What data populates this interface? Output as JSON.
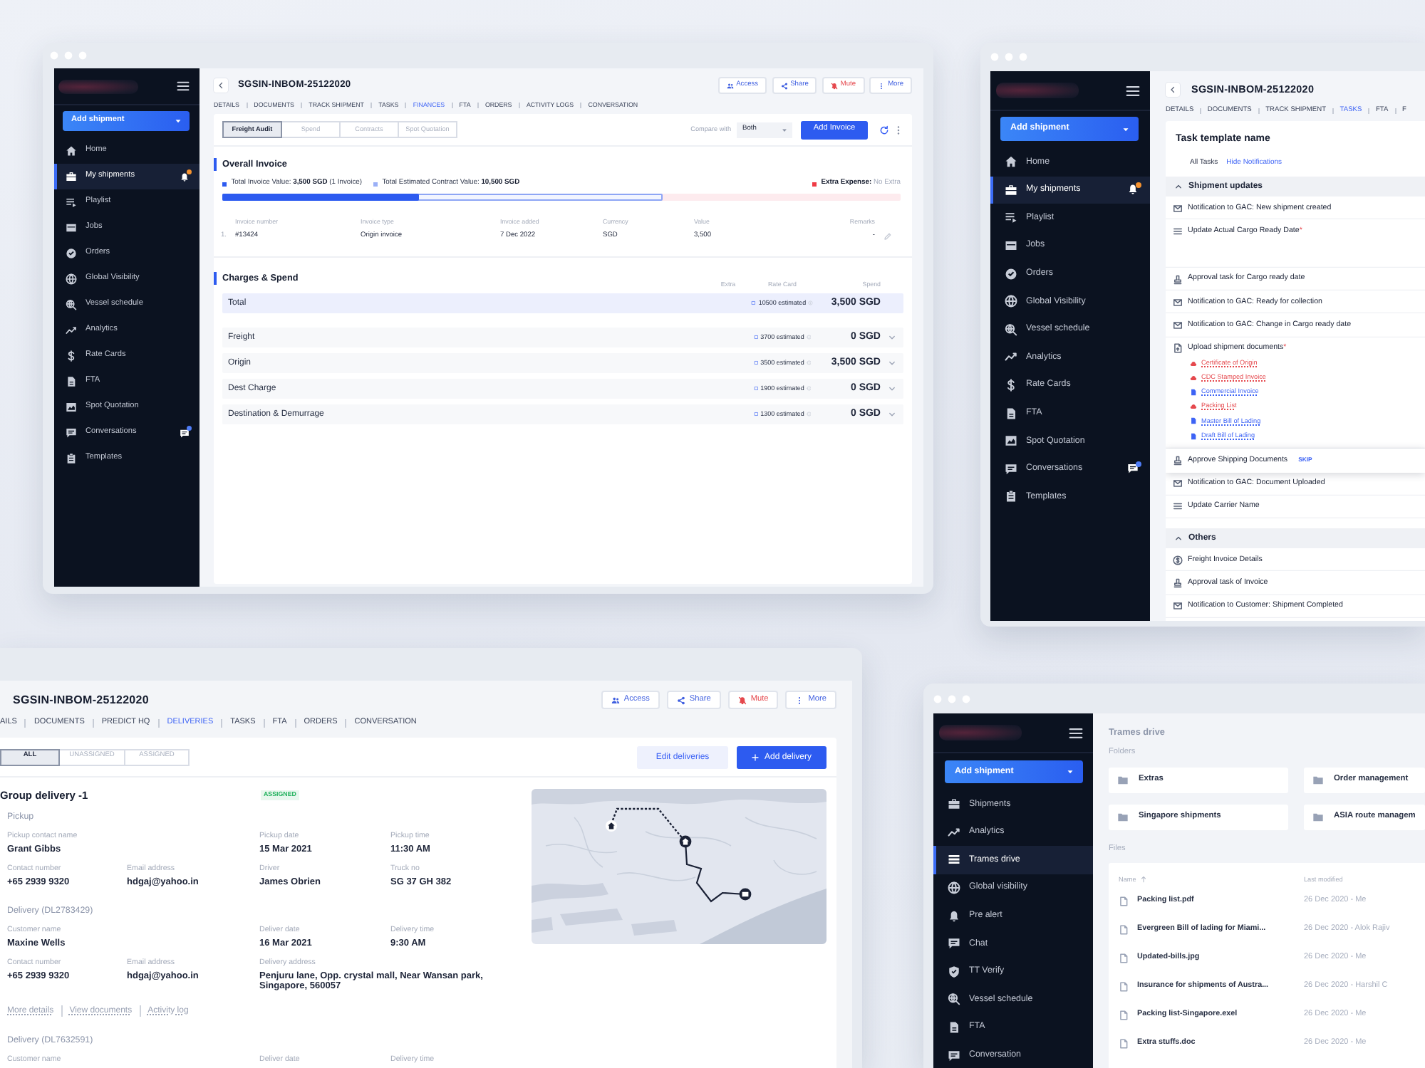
{
  "windows": [
    {
      "kind": "finances",
      "sidebar": {
        "add_button": "Add shipment",
        "items": [
          {
            "label": "Home",
            "kind": "home",
            "selected": false
          },
          {
            "label": "My shipments",
            "kind": "shipments",
            "selected": true,
            "badge": {
              "color": "#f5922f"
            }
          },
          {
            "label": "Playlist",
            "kind": "playlist",
            "selected": false
          },
          {
            "label": "Jobs",
            "kind": "jobs",
            "selected": false
          },
          {
            "label": "Orders",
            "kind": "orders",
            "selected": false
          },
          {
            "label": "Global Visibility",
            "kind": "globe",
            "selected": false
          },
          {
            "label": "Vessel schedule",
            "kind": "vessel",
            "selected": false
          },
          {
            "label": "Analytics",
            "kind": "analytics",
            "selected": false
          },
          {
            "label": "Rate Cards",
            "kind": "rates",
            "selected": false
          },
          {
            "label": "FTA",
            "kind": "fta",
            "selected": false
          },
          {
            "label": "Spot Quotation",
            "kind": "quotation",
            "selected": false
          },
          {
            "label": "Conversations",
            "kind": "chat",
            "selected": false,
            "badge": {
              "color": "#4f7df7"
            }
          },
          {
            "label": "Templates",
            "kind": "templates",
            "selected": false
          }
        ]
      },
      "title": "SGSIN-INBOM-25122020",
      "actions": [
        {
          "label": "Access",
          "kind": "access"
        },
        {
          "label": "Share",
          "kind": "share"
        },
        {
          "label": "Mute",
          "kind": "mute"
        },
        {
          "label": "More",
          "kind": "more"
        }
      ],
      "tabs": [
        {
          "label": "DETAILS",
          "selected": false
        },
        {
          "label": "DOCUMENTS",
          "selected": false
        },
        {
          "label": "TRACK SHIPMENT",
          "selected": false
        },
        {
          "label": "TASKS",
          "selected": false
        },
        {
          "label": "FINANCES",
          "selected": true
        },
        {
          "label": "FTA",
          "selected": false
        },
        {
          "label": "ORDERS",
          "selected": false
        },
        {
          "label": "ACTIVITY LOGS",
          "selected": false
        },
        {
          "label": "CONVERSATION",
          "selected": false
        }
      ],
      "subtabs": [
        {
          "label": "Freight Audit",
          "selected": true
        },
        {
          "label": "Spend",
          "selected": false
        },
        {
          "label": "Contracts",
          "selected": false
        },
        {
          "label": "Spot Quotation",
          "selected": false
        }
      ],
      "compare": {
        "label": "Compare with",
        "value": "Both"
      },
      "add_button": "Add Invoice",
      "overall": {
        "title": "Overall Invoice",
        "legend": [
          {
            "text": "Total Invoice Value: **3,500 SGD** (1 Invoice)",
            "color": "#2d5bf0"
          },
          {
            "text": "Total Estimated Contract Value: **10,500 SGD**",
            "color": "#9bb0f7"
          },
          {
            "text": "**Extra Expense:** No Extra",
            "color": "#ef3b45"
          }
        ],
        "invoice_bar": {
          "level": 0.29
        },
        "contract_bar": {
          "level": 0.65
        },
        "columns": [
          "Invoice number",
          "Invoice type",
          "Invoice added",
          "Currency",
          "Value",
          "Remarks"
        ],
        "rows": [
          {
            "index": "1.",
            "cells": [
              "#13424",
              "Origin invoice",
              "7 Dec 2022",
              "SGD",
              "3,500",
              "-"
            ]
          }
        ]
      },
      "charges": {
        "title": "Charges & Spend",
        "columns": [
          "Extra",
          "Rate Card",
          "Spend"
        ],
        "rows": [
          {
            "label": "Total",
            "kind": "total",
            "rate_card": "10500 estimated",
            "spend": "3,500 SGD"
          },
          {
            "label": "Freight",
            "kind": "charge",
            "rate_card": "3700 estimated",
            "spend": "0 SGD"
          },
          {
            "label": "Origin",
            "kind": "charge",
            "rate_card": "3500 estimated",
            "spend": "3,500 SGD"
          },
          {
            "label": "Dest Charge",
            "kind": "charge",
            "rate_card": "1900 estimated",
            "spend": "0 SGD"
          },
          {
            "label": "Destination & Demurrage",
            "kind": "charge",
            "rate_card": "1300 estimated",
            "spend": "0 SGD"
          }
        ]
      }
    },
    {
      "kind": "tasks",
      "sidebar": {
        "add_button": "Add shipment",
        "items": [
          {
            "label": "Home",
            "kind": "home",
            "selected": false
          },
          {
            "label": "My shipments",
            "kind": "shipments",
            "selected": true,
            "badge": {
              "color": "#f5922f"
            }
          },
          {
            "label": "Playlist",
            "kind": "playlist",
            "selected": false
          },
          {
            "label": "Jobs",
            "kind": "jobs",
            "selected": false
          },
          {
            "label": "Orders",
            "kind": "orders",
            "selected": false
          },
          {
            "label": "Global Visibility",
            "kind": "globe",
            "selected": false
          },
          {
            "label": "Vessel schedule",
            "kind": "vessel",
            "selected": false
          },
          {
            "label": "Analytics",
            "kind": "analytics",
            "selected": false
          },
          {
            "label": "Rate Cards",
            "kind": "rates",
            "selected": false
          },
          {
            "label": "FTA",
            "kind": "fta",
            "selected": false
          },
          {
            "label": "Spot Quotation",
            "kind": "quotation",
            "selected": false
          },
          {
            "label": "Conversations",
            "kind": "chat",
            "selected": false,
            "badge": {
              "color": "#4f7df7"
            }
          },
          {
            "label": "Templates",
            "kind": "templates",
            "selected": false
          }
        ]
      },
      "title": "SGSIN-INBOM-25122020",
      "tabs": [
        {
          "label": "DETAILS",
          "selected": false
        },
        {
          "label": "DOCUMENTS",
          "selected": false
        },
        {
          "label": "TRACK SHIPMENT",
          "selected": false
        },
        {
          "label": "TASKS",
          "selected": true
        },
        {
          "label": "FTA",
          "selected": false
        },
        {
          "label": "F",
          "selected": false
        }
      ],
      "template_name": "Task template name",
      "filter_label": "All Tasks",
      "toggle_link": "Hide Notifications",
      "groups": [
        {
          "title": "Shipment updates",
          "expanded": true,
          "tasks": [
            {
              "label": "Notification to GAC: New shipment created",
              "kind": "notification",
              "selected": false
            },
            {
              "label": "Update Actual Cargo Ready Date",
              "kind": "update",
              "required_mark": "*",
              "selected": false
            },
            {
              "label": "Approval task for Cargo ready date",
              "kind": "approval",
              "selected": false
            },
            {
              "label": "Notification to GAC: Ready for collection",
              "kind": "notification",
              "selected": false
            },
            {
              "label": "Notification to GAC: Change in Cargo ready date",
              "kind": "notification",
              "selected": false
            },
            {
              "label": "Upload shipment documents",
              "kind": "upload",
              "required_mark": "*",
              "selected": false,
              "documents": [
                {
                  "label": "Certificate of Origin",
                  "uploaded": false
                },
                {
                  "label": "CDC Stamped Invoice",
                  "uploaded": false
                },
                {
                  "label": "Commercial Invoice",
                  "uploaded": true
                },
                {
                  "label": "Packing List",
                  "uploaded": false
                },
                {
                  "label": "Master Bill of Lading",
                  "uploaded": true
                },
                {
                  "label": "Draft Bill of Lading",
                  "uploaded": true
                }
              ]
            },
            {
              "label": "Approve Shipping Documents",
              "kind": "approval",
              "selected": true,
              "action": "SKIP"
            },
            {
              "label": "Notification to GAC: Document Uploaded",
              "kind": "notification",
              "selected": false
            },
            {
              "label": "Update Carrier Name",
              "kind": "update",
              "selected": false
            }
          ]
        },
        {
          "title": "Others",
          "expanded": true,
          "tasks": [
            {
              "label": "Freight Invoice Details",
              "kind": "invoice",
              "selected": false
            },
            {
              "label": "Approval task of Invoice",
              "kind": "approval",
              "selected": false
            },
            {
              "label": "Notification to Customer: Shipment Completed",
              "kind": "notification",
              "selected": false
            }
          ]
        }
      ]
    },
    {
      "kind": "deliveries",
      "title": "SGSIN-INBOM-25122020",
      "actions": [
        {
          "label": "Access",
          "kind": "access"
        },
        {
          "label": "Share",
          "kind": "share"
        },
        {
          "label": "Mute",
          "kind": "mute"
        },
        {
          "label": "More",
          "kind": "more"
        }
      ],
      "tabs": [
        {
          "label": "AILS",
          "selected": false
        },
        {
          "label": "DOCUMENTS",
          "selected": false
        },
        {
          "label": "PREDICT HQ",
          "selected": false
        },
        {
          "label": "DELIVERIES",
          "selected": true
        },
        {
          "label": "TASKS",
          "selected": false
        },
        {
          "label": "FTA",
          "selected": false
        },
        {
          "label": "ORDERS",
          "selected": false
        },
        {
          "label": "CONVERSATION",
          "selected": false
        }
      ],
      "filters": [
        {
          "label": "ALL",
          "selected": true
        },
        {
          "label": "UNASSIGNED",
          "selected": false
        },
        {
          "label": "ASSIGNED",
          "selected": false
        }
      ],
      "edit_button": "Edit deliveries",
      "add_button": "Add delivery",
      "group": {
        "title": "Group delivery -1",
        "status": "ASSIGNED",
        "sections": [
          {
            "title": "Pickup",
            "rows": [
              {
                "left": [
                  {
                    "label": "Pickup contact name",
                    "value": "Grant Gibbs"
                  }
                ],
                "right": [
                  {
                    "label": "Pickup date",
                    "value": "15 Mar 2021"
                  },
                  {
                    "label": "Pickup time",
                    "value": "11:30 AM"
                  }
                ]
              },
              {
                "left": [
                  {
                    "label": "Contact number",
                    "value": "+65 2939 9320"
                  },
                  {
                    "label": "Email address",
                    "value": "hdgaj@yahoo.in"
                  }
                ],
                "right": [
                  {
                    "label": "Driver",
                    "value": "James Obrien"
                  },
                  {
                    "label": "Truck no",
                    "value": "SG 37 GH 382"
                  }
                ]
              }
            ]
          },
          {
            "title": "Delivery (DL2783429)",
            "rows": [
              {
                "left": [
                  {
                    "label": "Customer name",
                    "value": "Maxine Wells"
                  }
                ],
                "right": [
                  {
                    "label": "Deliver date",
                    "value": "16 Mar 2021"
                  },
                  {
                    "label": "Delivery time",
                    "value": "9:30 AM"
                  }
                ]
              },
              {
                "left": [
                  {
                    "label": "Contact number",
                    "value": "+65 2939 9320"
                  },
                  {
                    "label": "Email address",
                    "value": "hdgaj@yahoo.in"
                  }
                ],
                "right": [
                  {
                    "label": "Delivery address",
                    "value": "Penjuru lane, Opp. crystal mall, Near Wansan park, Singapore, 560057"
                  }
                ]
              }
            ],
            "links": [
              "More details",
              "View documents",
              "Activity log"
            ]
          },
          {
            "title": "Delivery (DL7632591)",
            "rows": [
              {
                "left": [
                  {
                    "label": "Customer name"
                  }
                ],
                "right": [
                  {
                    "label": "Deliver date"
                  },
                  {
                    "label": "Delivery time"
                  }
                ]
              }
            ]
          }
        ]
      }
    },
    {
      "kind": "drive",
      "sidebar": {
        "add_button": "Add shipment",
        "items": [
          {
            "label": "Shipments",
            "kind": "shipments",
            "selected": false
          },
          {
            "label": "Analytics",
            "kind": "analytics",
            "selected": false
          },
          {
            "label": "Trames drive",
            "kind": "drive",
            "selected": true
          },
          {
            "label": "Global visibility",
            "kind": "globe",
            "selected": false
          },
          {
            "label": "Pre alert",
            "kind": "alert",
            "selected": false
          },
          {
            "label": "Chat",
            "kind": "chat",
            "selected": false
          },
          {
            "label": "TT Verify",
            "kind": "verify",
            "selected": false
          },
          {
            "label": "Vessel schedule",
            "kind": "vessel",
            "selected": false
          },
          {
            "label": "FTA",
            "kind": "fta",
            "selected": false
          },
          {
            "label": "Conversation",
            "kind": "chat",
            "selected": false
          }
        ]
      },
      "title": "Trames drive",
      "folders_label": "Folders",
      "folders": [
        "Extras",
        "Order management",
        "Singapore shipments",
        "ASIA route managem"
      ],
      "files_label": "Files",
      "columns": [
        {
          "label": "Name",
          "sorted": true
        },
        {
          "label": "Last modified",
          "sorted": false
        }
      ],
      "files": [
        {
          "name": "Packing list.pdf",
          "modified": "26 Dec 2020 - Me"
        },
        {
          "name": "Evergreen Bill of lading for Miami...",
          "modified": "26 Dec 2020 - Alok Rajiv"
        },
        {
          "name": "Updated-bills.jpg",
          "modified": "26 Dec 2020 - Me"
        },
        {
          "name": "Insurance for shipments of Austra...",
          "modified": "26 Dec 2020 - Harshil C"
        },
        {
          "name": "Packing list-Singapore.exel",
          "modified": "26 Dec 2020 - Me"
        },
        {
          "name": "Extra stuffs.doc",
          "modified": "26 Dec 2020 - Me"
        }
      ]
    }
  ]
}
